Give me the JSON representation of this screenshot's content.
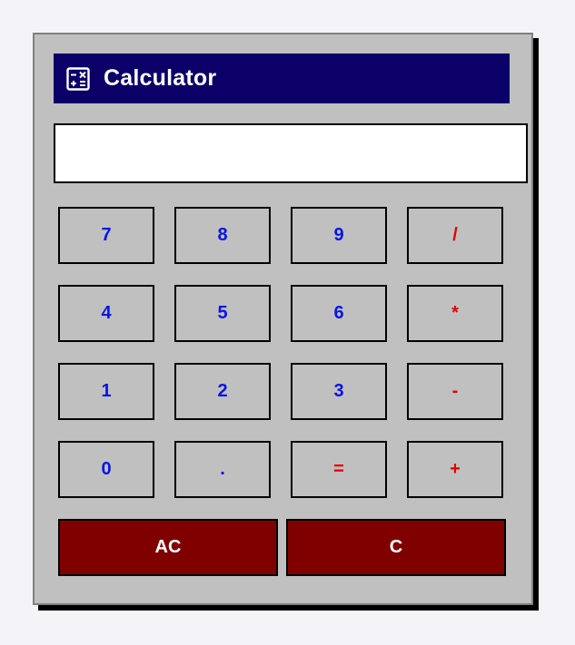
{
  "window": {
    "title": "Calculator",
    "icon": "calculator-icon"
  },
  "display": {
    "value": ""
  },
  "keys": {
    "row1": [
      "7",
      "8",
      "9",
      "/"
    ],
    "row2": [
      "4",
      "5",
      "6",
      "*"
    ],
    "row3": [
      "1",
      "2",
      "3",
      "-"
    ],
    "row4": [
      "0",
      ".",
      "=",
      "+"
    ],
    "row5": [
      "AC",
      "C"
    ]
  },
  "colors": {
    "title_bar": "#0a0068",
    "number_text": "#0a14e6",
    "operator_text": "#e60000",
    "clear_buttons": "#800000",
    "window_bg": "#c0c0c0"
  }
}
